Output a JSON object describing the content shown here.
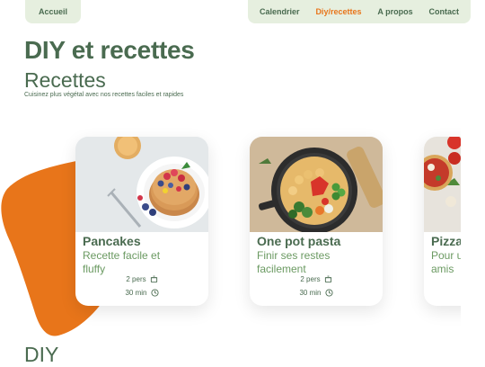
{
  "nav": {
    "home": "Accueil",
    "links": [
      {
        "label": "Calendrier",
        "active": false
      },
      {
        "label": "Diy/recettes",
        "active": true
      },
      {
        "label": "A propos",
        "active": false
      },
      {
        "label": "Contact",
        "active": false
      }
    ]
  },
  "header": {
    "title": "DIY et recettes",
    "subtitle": "Recettes",
    "tagline": "Cuisinez plus végétal avec nos recettes faciles et rapides"
  },
  "recipes": [
    {
      "title": "Pancakes",
      "description": "Recette facile et fluffy",
      "servings": "2 pers",
      "duration": "30 min"
    },
    {
      "title": "One pot pasta",
      "description": "Finir ses restes facilement",
      "servings": "2 pers",
      "duration": "30 min"
    },
    {
      "title": "Pizza",
      "description": "Pour un apéro entre amis"
    }
  ],
  "sections": {
    "diy": "DIY"
  },
  "colors": {
    "accent": "#e8751a",
    "primary": "#4a6b50",
    "nav_bg": "#e6efdf"
  }
}
